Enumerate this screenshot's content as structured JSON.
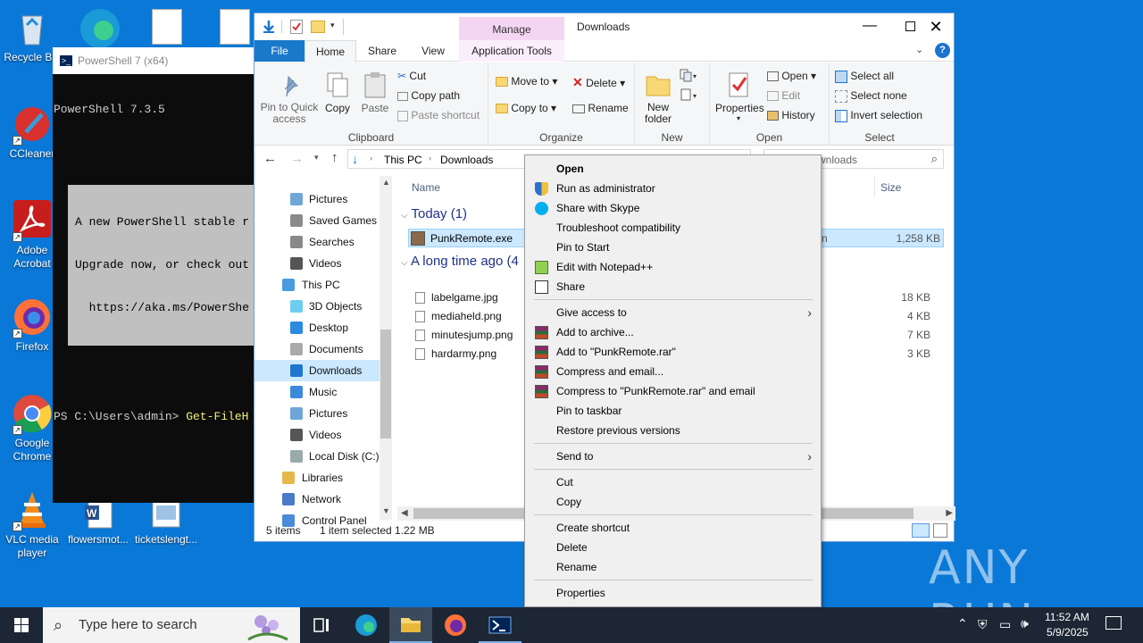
{
  "desktop_icons": [
    {
      "label": "Recycle Bin",
      "icon": "recycle-bin-icon"
    },
    {
      "label": "CCleaner",
      "icon": "ccleaner-icon"
    },
    {
      "label": "Adobe Acrobat",
      "icon": "acrobat-icon"
    },
    {
      "label": "Firefox",
      "icon": "firefox-icon"
    },
    {
      "label": "Google Chrome",
      "icon": "chrome-icon"
    },
    {
      "label": "VLC media player",
      "icon": "vlc-icon"
    },
    {
      "label": "flowersmot...",
      "icon": "word-doc-icon"
    },
    {
      "label": "ticketslengt...",
      "icon": "image-file-icon"
    }
  ],
  "powershell": {
    "title": "PowerShell 7 (x64)",
    "version_line": "PowerShell 7.3.5",
    "banner": [
      "A new PowerShell stable r",
      "Upgrade now, or check out",
      "  https://aka.ms/PowerShe"
    ],
    "prompt": "PS C:\\Users\\admin> ",
    "command": "Get-FileH"
  },
  "explorer": {
    "title": "Downloads",
    "context_tab": "Manage",
    "tabs": [
      "File",
      "Home",
      "Share",
      "View",
      "Application Tools"
    ],
    "ribbon": {
      "clipboard": {
        "label": "Clipboard",
        "pin": "Pin to Quick access",
        "copy": "Copy",
        "paste": "Paste",
        "cut": "Cut",
        "copy_path": "Copy path",
        "paste_shortcut": "Paste shortcut"
      },
      "organize": {
        "label": "Organize",
        "move_to": "Move to",
        "copy_to": "Copy to",
        "delete": "Delete",
        "rename": "Rename"
      },
      "new": {
        "label": "New",
        "new_folder": "New folder"
      },
      "open": {
        "label": "Open",
        "properties": "Properties",
        "open": "Open",
        "edit": "Edit",
        "history": "History"
      },
      "select": {
        "label": "Select",
        "select_all": "Select all",
        "select_none": "Select none",
        "invert": "Invert selection"
      }
    },
    "address": {
      "crumbs": [
        "This PC",
        "Downloads"
      ],
      "search_placeholder": "Search Downloads",
      "search_visible": "wnloads"
    },
    "nav_items": [
      {
        "label": "Pictures",
        "indent": 1
      },
      {
        "label": "Saved Games",
        "indent": 1
      },
      {
        "label": "Searches",
        "indent": 1
      },
      {
        "label": "Videos",
        "indent": 1
      },
      {
        "label": "This PC",
        "indent": 0
      },
      {
        "label": "3D Objects",
        "indent": 1
      },
      {
        "label": "Desktop",
        "indent": 1
      },
      {
        "label": "Documents",
        "indent": 1
      },
      {
        "label": "Downloads",
        "indent": 1,
        "selected": true
      },
      {
        "label": "Music",
        "indent": 1
      },
      {
        "label": "Pictures",
        "indent": 1
      },
      {
        "label": "Videos",
        "indent": 1
      },
      {
        "label": "Local Disk (C:)",
        "indent": 1
      },
      {
        "label": "Libraries",
        "indent": 0
      },
      {
        "label": "Network",
        "indent": 0
      },
      {
        "label": "Control Panel",
        "indent": 0
      }
    ],
    "columns": {
      "name": "Name",
      "size": "Size"
    },
    "groups": [
      {
        "label": "Today (1)",
        "files": [
          {
            "name": "PunkRemote.exe",
            "type_partial": "n",
            "size": "1,258 KB",
            "selected": true
          }
        ]
      },
      {
        "label": "A long time ago (4",
        "files": [
          {
            "name": "labelgame.jpg",
            "size": "18 KB"
          },
          {
            "name": "mediaheld.png",
            "size": "4 KB"
          },
          {
            "name": "minutesjump.png",
            "size": "7 KB"
          },
          {
            "name": "hardarmy.png",
            "size": "3 KB"
          }
        ]
      }
    ],
    "status": {
      "items": "5 items",
      "selected": "1 item selected",
      "size": "1.22 MB"
    }
  },
  "context_menu": [
    {
      "label": "Open",
      "bold": true
    },
    {
      "label": "Run as administrator",
      "icon": "shield-icon"
    },
    {
      "label": "Share with Skype",
      "icon": "skype-icon"
    },
    {
      "label": "Troubleshoot compatibility"
    },
    {
      "label": "Pin to Start"
    },
    {
      "label": "Edit with Notepad++",
      "icon": "notepadpp-icon"
    },
    {
      "label": "Share",
      "icon": "share-icon"
    },
    {
      "sep": true
    },
    {
      "label": "Give access to",
      "submenu": true
    },
    {
      "label": "Add to archive...",
      "icon": "winrar-icon"
    },
    {
      "label": "Add to \"PunkRemote.rar\"",
      "icon": "winrar-icon"
    },
    {
      "label": "Compress and email...",
      "icon": "winrar-icon"
    },
    {
      "label": "Compress to \"PunkRemote.rar\" and email",
      "icon": "winrar-icon"
    },
    {
      "label": "Pin to taskbar"
    },
    {
      "label": "Restore previous versions"
    },
    {
      "sep": true
    },
    {
      "label": "Send to",
      "submenu": true
    },
    {
      "sep": true
    },
    {
      "label": "Cut"
    },
    {
      "label": "Copy"
    },
    {
      "sep": true
    },
    {
      "label": "Create shortcut"
    },
    {
      "label": "Delete"
    },
    {
      "label": "Rename"
    },
    {
      "sep": true
    },
    {
      "label": "Properties"
    }
  ],
  "taskbar": {
    "search_placeholder": "Type here to search",
    "time": "11:52 AM",
    "date": "5/9/2025"
  },
  "watermark": "ANY RUN"
}
